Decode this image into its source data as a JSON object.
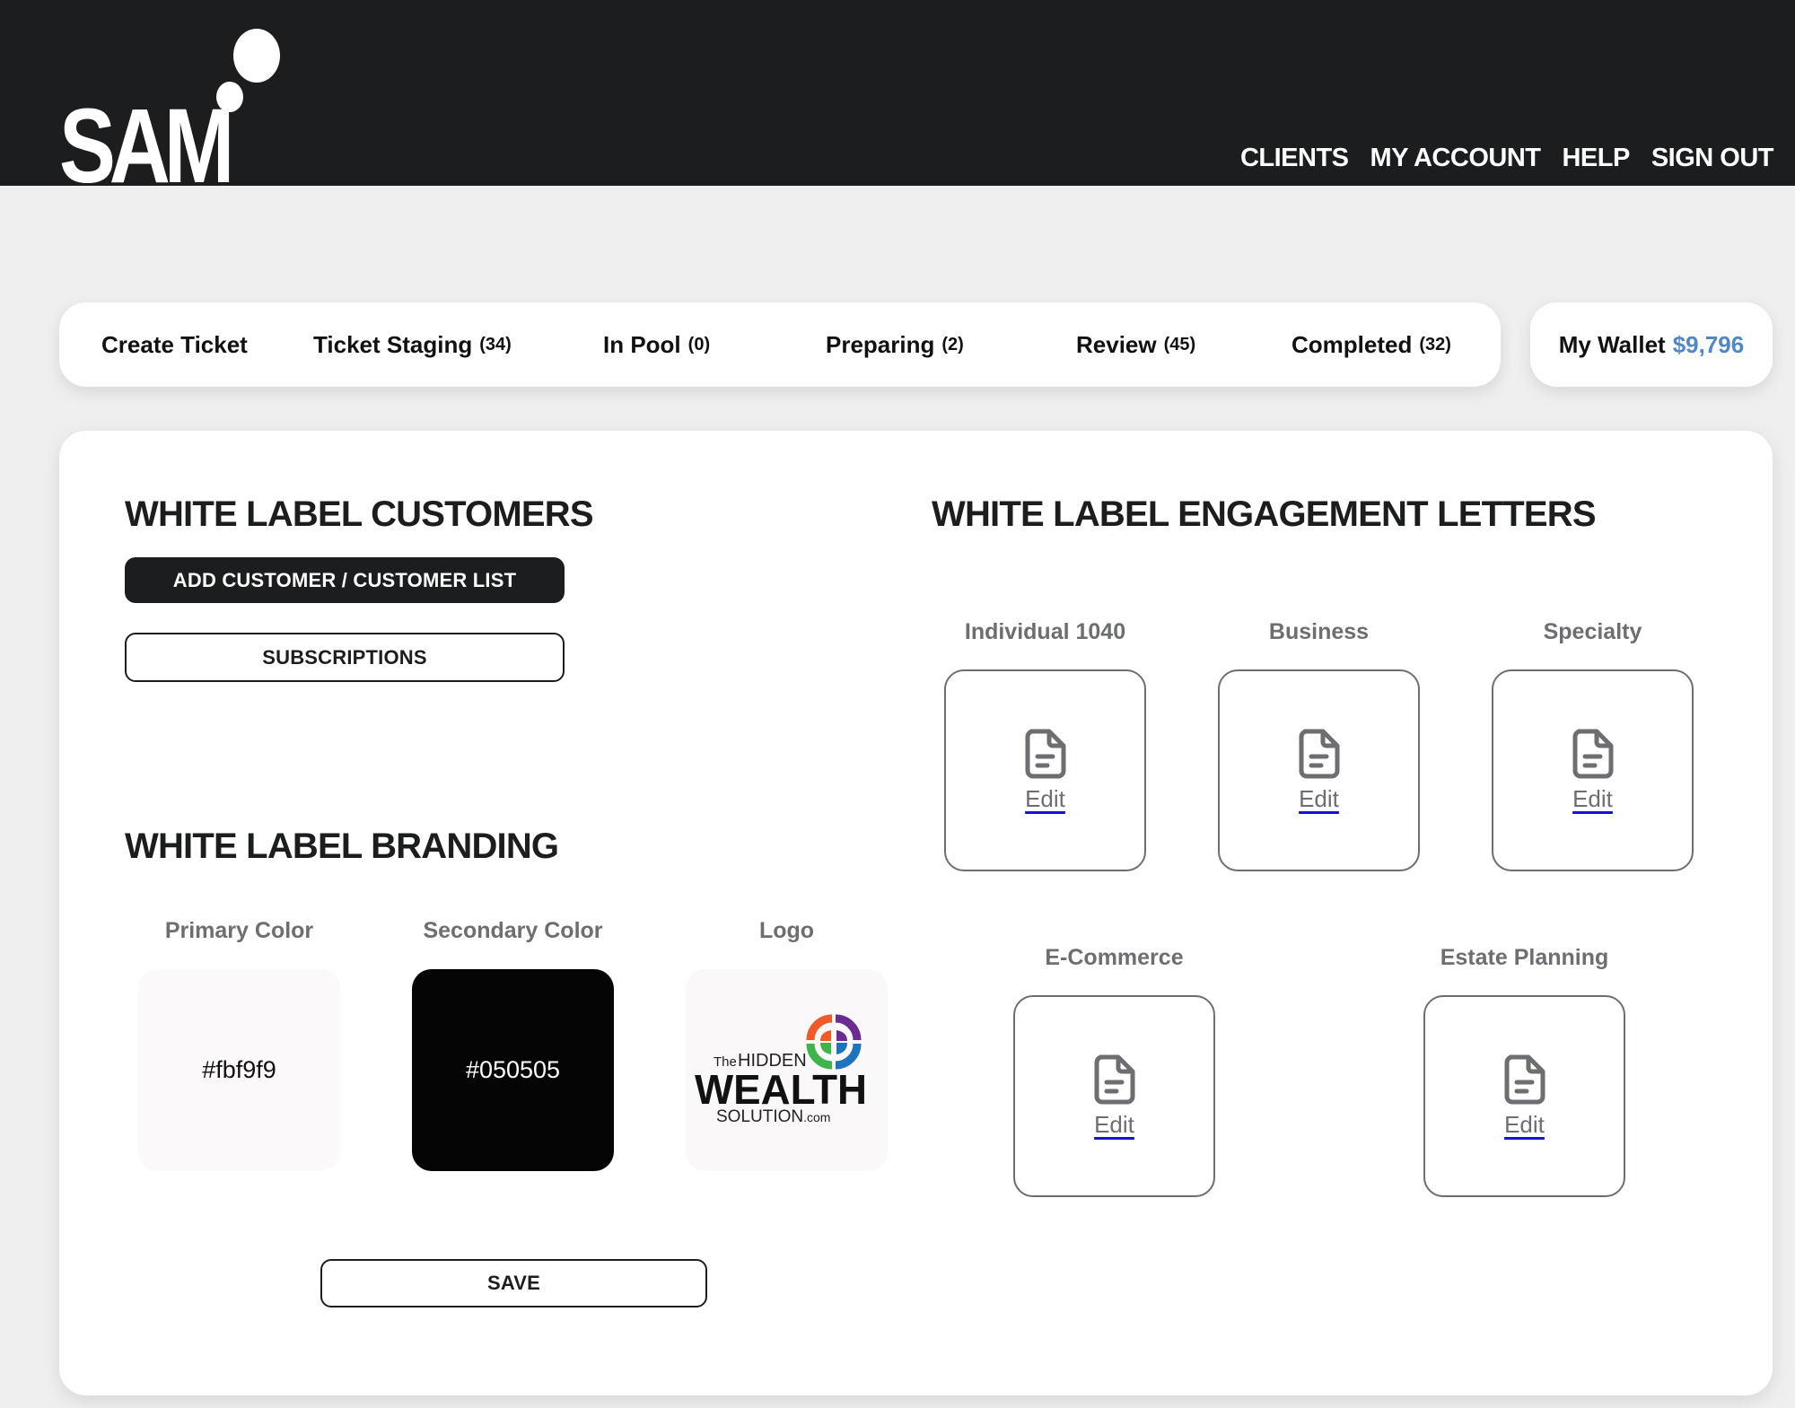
{
  "header": {
    "logo_text": "SAM",
    "nav": [
      {
        "label": "CLIENTS"
      },
      {
        "label": "MY ACCOUNT"
      },
      {
        "label": "HELP"
      },
      {
        "label": "SIGN OUT"
      }
    ]
  },
  "tabs": [
    {
      "label": "Create Ticket",
      "count": ""
    },
    {
      "label": "Ticket Staging",
      "count": "(34)"
    },
    {
      "label": "In Pool",
      "count": "(0)"
    },
    {
      "label": "Preparing",
      "count": "(2)"
    },
    {
      "label": "Review",
      "count": "(45)"
    },
    {
      "label": "Completed",
      "count": "(32)"
    }
  ],
  "wallet": {
    "label": "My Wallet",
    "amount": "$9,796",
    "amount_color": "#4f88c6"
  },
  "customers": {
    "heading": "WHITE LABEL CUSTOMERS",
    "add_button": "ADD CUSTOMER / CUSTOMER LIST",
    "subscriptions_button": "SUBSCRIPTIONS"
  },
  "branding": {
    "heading": "WHITE LABEL BRANDING",
    "primary_label": "Primary Color",
    "primary_value": "#fbf9f9",
    "secondary_label": "Secondary Color",
    "secondary_value": "#050505",
    "logo_label": "Logo",
    "logo": {
      "line1_small": "The",
      "line1": "HIDDEN",
      "line2": "WEALTH",
      "line3": "SOLUTION",
      "line3_suffix": ".com",
      "colors": [
        "#f05a28",
        "#6a2c91",
        "#3cb54a",
        "#1c75bc"
      ]
    },
    "save_button": "SAVE"
  },
  "engagement": {
    "heading": "WHITE LABEL ENGAGEMENT LETTERS",
    "letters": [
      {
        "label": "Individual 1040",
        "action": "Edit",
        "icon": "document-icon"
      },
      {
        "label": "Business",
        "action": "Edit",
        "icon": "document-icon"
      },
      {
        "label": "Specialty",
        "action": "Edit",
        "icon": "document-icon"
      },
      {
        "label": "E-Commerce",
        "action": "Edit",
        "icon": "document-icon"
      },
      {
        "label": "Estate Planning",
        "action": "Edit",
        "icon": "document-icon"
      }
    ]
  }
}
